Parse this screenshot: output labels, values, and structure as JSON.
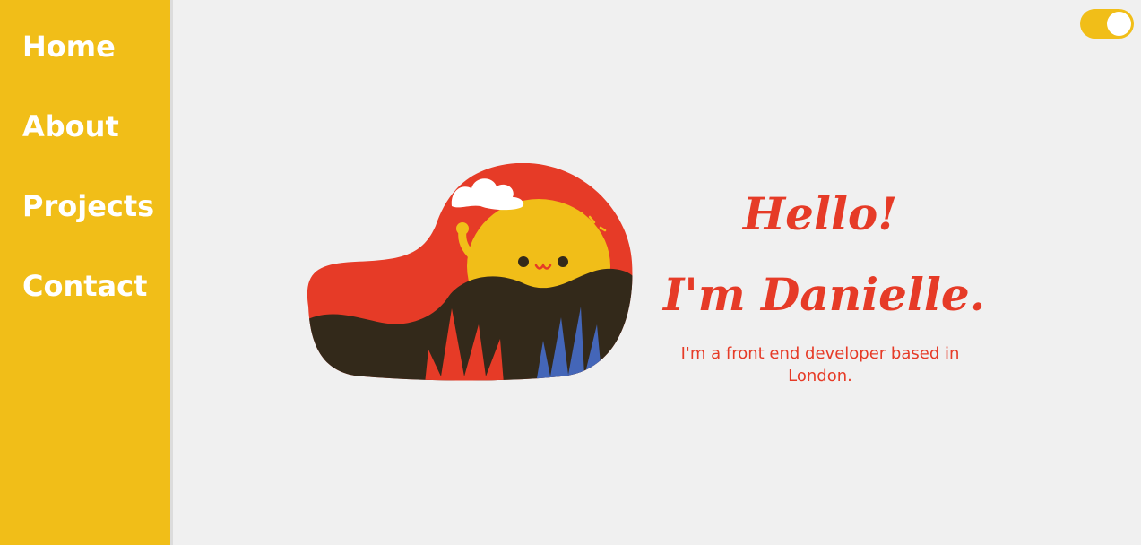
{
  "sidebar": {
    "items": [
      {
        "label": "Home"
      },
      {
        "label": "About"
      },
      {
        "label": "Projects"
      },
      {
        "label": "Contact"
      }
    ]
  },
  "theme_toggle": {
    "state": "on"
  },
  "hero": {
    "greeting_line_1": "Hello!",
    "greeting_line_2": "I'm Danielle.",
    "tagline": "I'm a front end developer based in London."
  },
  "colors": {
    "accent_yellow": "#f1be18",
    "accent_red": "#e63b27",
    "background": "#f0f0f0",
    "dark": "#33291a",
    "blue": "#4466b8"
  }
}
